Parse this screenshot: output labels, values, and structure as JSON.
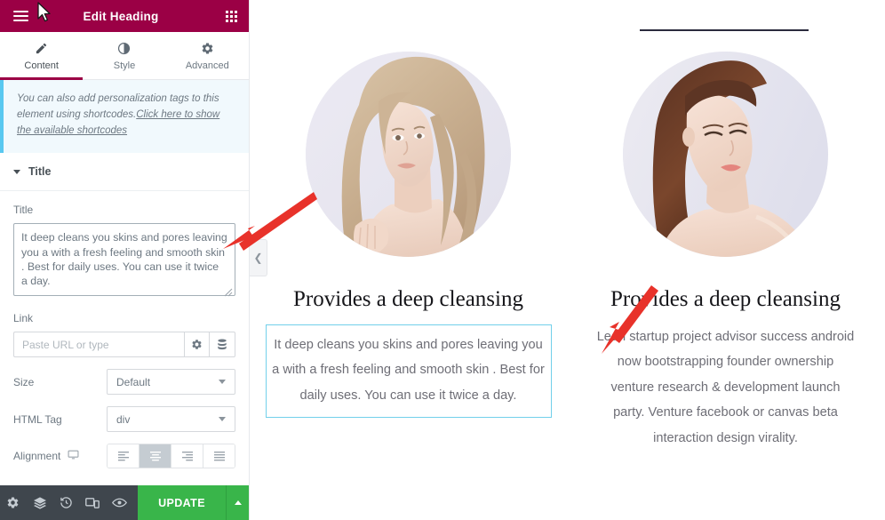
{
  "panel": {
    "header": {
      "title": "Edit Heading",
      "menu_icon": "hamburger-icon",
      "grid_icon": "apps-grid-icon"
    },
    "tabs": [
      {
        "label": "Content",
        "icon": "pencil-icon",
        "active": true
      },
      {
        "label": "Style",
        "icon": "contrast-circle-icon",
        "active": false
      },
      {
        "label": "Advanced",
        "icon": "gear-icon",
        "active": false
      }
    ],
    "notice": {
      "text": "You can also add personalization tags to this element using shortcodes.",
      "link_text": "Click here to show the available shortcodes",
      "accent_color": "#59c8f0"
    },
    "section": {
      "label": "Title",
      "expanded": true
    },
    "controls": {
      "title_label": "Title",
      "title_value": "It deep cleans you skins and pores leaving you a with a fresh feeling and smooth skin . Best for daily uses. You can use it twice a day.",
      "link_label": "Link",
      "link_value": "",
      "link_placeholder": "Paste URL or type",
      "link_options_icon": "gear-icon",
      "link_dynamic_icon": "database-icon",
      "size_label": "Size",
      "size_value": "Default",
      "html_tag_label": "HTML Tag",
      "html_tag_value": "div",
      "alignment_label": "Alignment",
      "alignment_device_icon": "monitor-icon",
      "alignment_options": [
        "align-left",
        "align-center",
        "align-right",
        "align-justify"
      ],
      "alignment_selected": 1
    },
    "footer": {
      "icons": [
        "gear-icon",
        "layers-icon",
        "history-icon",
        "responsive-icon",
        "preview-eye-icon"
      ],
      "update_label": "UPDATE",
      "update_color": "#39b54a",
      "update_caret_icon": "caret-up-icon"
    },
    "header_color": "#9b0045"
  },
  "collapse_handle": {
    "icon": "chevron-left-icon"
  },
  "canvas": {
    "top_cut_text": [
      "",
      "",
      ""
    ],
    "columns": [
      {
        "photo_name": "blonde-woman-portrait",
        "heading": "Provides a deep cleansing",
        "body": "It deep cleans you skins and pores leaving you a with a fresh feeling and smooth skin . Best for daily uses. You can use it twice a day.",
        "selected": true,
        "selection_color": "#72d0ea"
      },
      {
        "photo_name": "brunette-woman-portrait",
        "heading": "Provides a deep cleansing",
        "body": "Lean startup project advisor success android now bootstrapping founder ownership venture research & development launch party. Venture facebook or canvas beta interaction design virality.",
        "selected": false
      }
    ]
  },
  "annotations": {
    "arrow_color": "#e8322a",
    "arrows": [
      {
        "name": "arrow-to-title-field"
      },
      {
        "name": "arrow-to-text-widget"
      }
    ]
  }
}
